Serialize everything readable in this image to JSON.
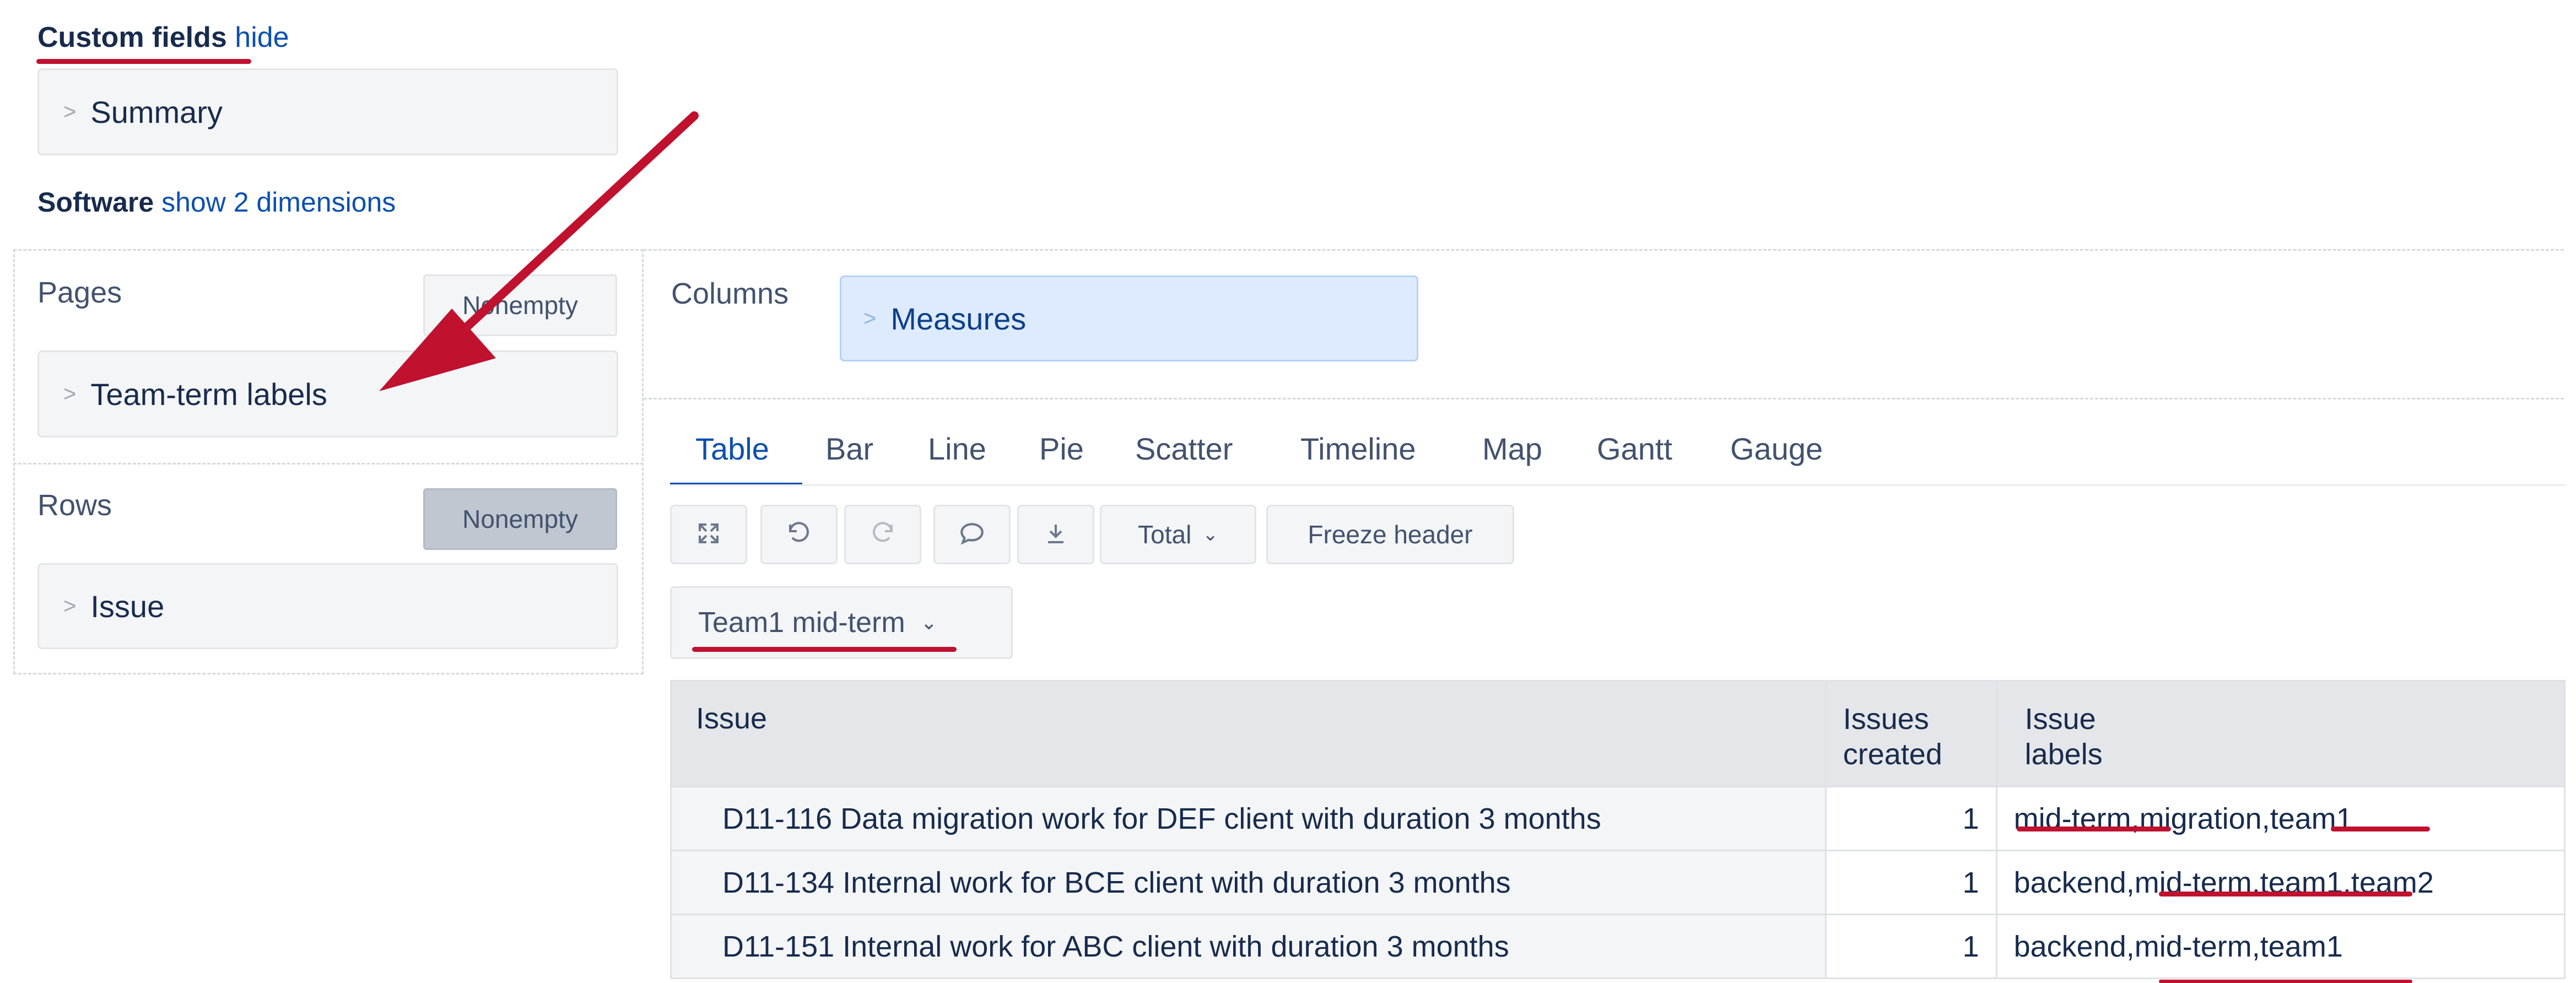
{
  "custom_fields": {
    "label": "Custom fields",
    "hide_link": "hide"
  },
  "summary": {
    "label": "Summary"
  },
  "software": {
    "label": "Software",
    "show_link": "show 2 dimensions"
  },
  "pages": {
    "label": "Pages",
    "nonempty": "Nonempty",
    "dimension": "Team-term labels"
  },
  "rows": {
    "label": "Rows",
    "nonempty": "Nonempty",
    "dimension": "Issue"
  },
  "columns": {
    "label": "Columns",
    "dimension": "Measures"
  },
  "tabs": [
    "Table",
    "Bar",
    "Line",
    "Pie",
    "Scatter",
    "Timeline",
    "Map",
    "Gantt",
    "Gauge"
  ],
  "toolbar": {
    "expand_icon": "expand-icon",
    "undo_icon": "undo-icon",
    "redo_icon": "redo-icon",
    "comment_icon": "comment-icon",
    "export_icon": "download-icon",
    "total_label": "Total",
    "freeze_label": "Freeze header"
  },
  "page_selector": {
    "value": "Team1 mid-term"
  },
  "table": {
    "headers": {
      "issue": "Issue",
      "created_1": "Issues",
      "created_2": "created",
      "labels_1": "Issue",
      "labels_2": "labels"
    },
    "rows": [
      {
        "issue": "D11-116 Data migration work for DEF client with duration 3 months",
        "created": "1",
        "labels": "mid-term,migration,team1"
      },
      {
        "issue": "D11-134 Internal work for BCE client with duration 3 months",
        "created": "1",
        "labels": "backend,mid-term,team1,team2"
      },
      {
        "issue": "D11-151 Internal work for ABC client with duration 3 months",
        "created": "1",
        "labels": "backend,mid-term,team1"
      }
    ]
  },
  "colors": {
    "accent_red": "#c0112f",
    "link_blue": "#0b4fb0",
    "measures_bg": "#deebff"
  }
}
